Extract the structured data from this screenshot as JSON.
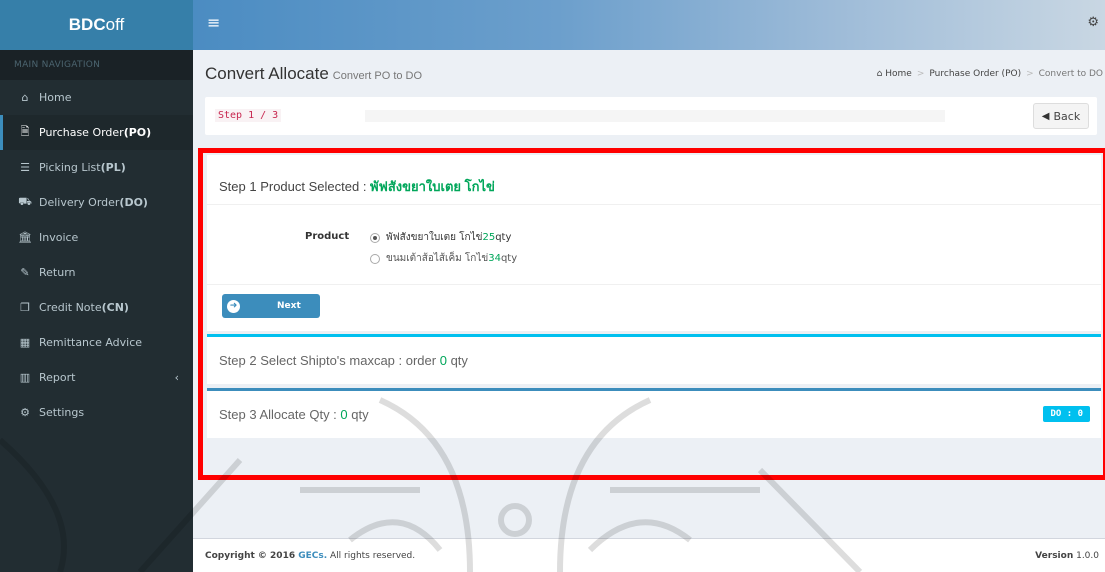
{
  "app": {
    "logo_bold": "BDC",
    "logo_light": "off"
  },
  "sidebar": {
    "header": "MAIN NAVIGATION",
    "items": [
      {
        "label": "Home",
        "suffix": "",
        "icon": "home-icon",
        "glyph": "⌂"
      },
      {
        "label": "Purchase Order ",
        "suffix": "(PO)",
        "icon": "document-icon",
        "glyph": "🗎"
      },
      {
        "label": "Picking List ",
        "suffix": "(PL)",
        "icon": "list-icon",
        "glyph": "☰"
      },
      {
        "label": "Delivery Order ",
        "suffix": "(DO)",
        "icon": "truck-icon",
        "glyph": "⛟"
      },
      {
        "label": "Invoice",
        "suffix": "",
        "icon": "bank-icon",
        "glyph": "🏛"
      },
      {
        "label": "Return",
        "suffix": "",
        "icon": "edit-icon",
        "glyph": "✎"
      },
      {
        "label": "Credit Note ",
        "suffix": "(CN)",
        "icon": "copy-icon",
        "glyph": "❐"
      },
      {
        "label": "Remittance Advice",
        "suffix": "",
        "icon": "calendar-icon",
        "glyph": "▦"
      },
      {
        "label": "Report",
        "suffix": "",
        "icon": "bar-chart-icon",
        "glyph": "▥"
      },
      {
        "label": "Settings",
        "suffix": "",
        "icon": "cogs-icon",
        "glyph": "⚙"
      }
    ],
    "active_index": 1
  },
  "header": {
    "title": "Convert Allocate",
    "subtitle": "Convert PO to DO",
    "breadcrumb": [
      "Home",
      "Purchase Order (PO)",
      "Convert to DO"
    ]
  },
  "step_bar": {
    "step_text": "Step 1 / 3",
    "back_label": "Back",
    "progress": 0.0
  },
  "step1": {
    "title_prefix": "Step 1 Product Selected : ",
    "title_product": "พัฟสังขยาใบเตย โกไข่",
    "field_label": "Product",
    "options": [
      {
        "name": "พัฟสังขยาใบเตย โกไข่ ",
        "qty": "25",
        "unit": " qty",
        "selected": true
      },
      {
        "name": "ขนมเต้าส้อไส้เค็ม โกไข่ ",
        "qty": "34",
        "unit": " qty",
        "selected": false
      }
    ],
    "next_label": "Next"
  },
  "step2": {
    "title": "Step 2 Select Shipto's maxcap : order ",
    "qty": "0",
    "unit": " qty"
  },
  "step3": {
    "title": "Step 3 Allocate Qty : ",
    "qty": "0",
    "unit": " qty",
    "badge": "DO : 0"
  },
  "footer": {
    "copyright_prefix": "Copyright © 2016 ",
    "brand": "GECs.",
    "copyright_suffix": " All rights reserved.",
    "version_label": "Version",
    "version_value": " 1.0.0"
  },
  "colors": {
    "accent": "#3c8dbc",
    "success": "#00a65a",
    "info": "#00c0ef",
    "highlight_frame": "#ff0000",
    "sidebar_bg": "#222d32"
  }
}
